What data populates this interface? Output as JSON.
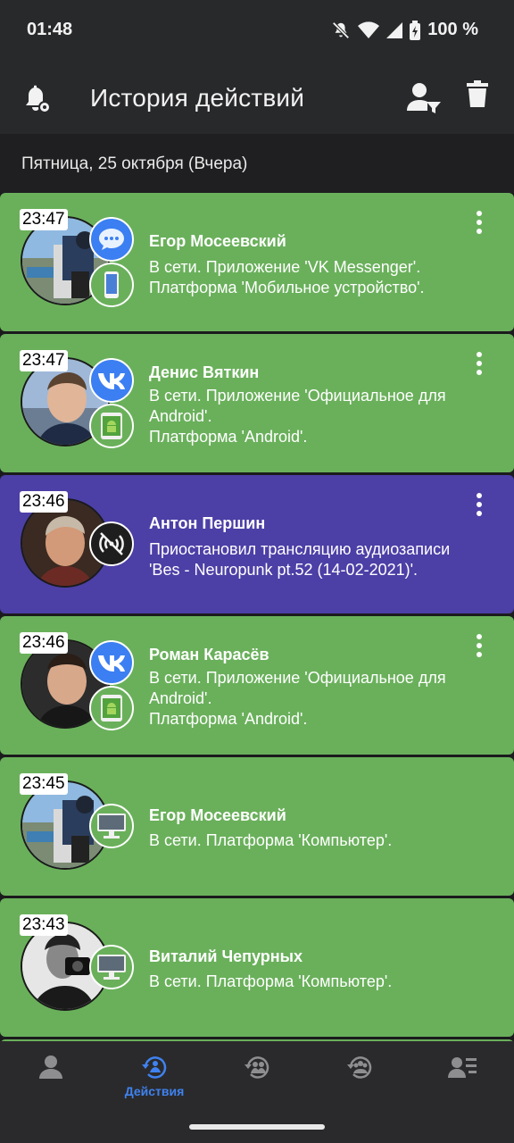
{
  "status_bar": {
    "time": "01:48",
    "battery": "100 %",
    "icons": [
      "mute-icon",
      "wifi-icon",
      "signal-icon",
      "battery-icon"
    ]
  },
  "app_bar": {
    "title": "История действий",
    "icons": [
      "bell-settings-icon",
      "user-filter-icon",
      "trash-icon"
    ]
  },
  "date_header": "Пятница, 25 октября (Вчера)",
  "colors": {
    "online_card": "#6ab05b",
    "audio_card": "#4c3fa6",
    "accent": "#3f82f0",
    "app_bar": "#28292b"
  },
  "events": [
    {
      "time": "23:47",
      "name": "Егор Мосеевский",
      "lines": [
        "В сети. Приложение 'VK Messenger'.",
        "Платформа 'Мобильное устройство'."
      ],
      "badges": [
        "messenger-icon",
        "mobile-phone-icon"
      ]
    },
    {
      "time": "23:47",
      "name": "Денис Вяткин",
      "lines": [
        "В сети. Приложение 'Официальное для",
        "Android'.",
        "Платформа 'Android'."
      ],
      "badges": [
        "vk-logo-icon",
        "android-tablet-icon"
      ]
    },
    {
      "time": "23:46",
      "name": "Антон Першин",
      "lines": [
        "Приостановил трансляцию аудиозаписи",
        "'Bes - Neuropunk pt.52 (14-02-2021)'."
      ],
      "badges": [
        "broadcast-off-icon"
      ]
    },
    {
      "time": "23:46",
      "name": "Роман Карасёв",
      "lines": [
        "В сети. Приложение 'Официальное для",
        "Android'.",
        "Платформа 'Android'."
      ],
      "badges": [
        "vk-logo-icon",
        "android-tablet-icon"
      ]
    },
    {
      "time": "23:45",
      "name": "Егор Мосеевский",
      "lines": [
        "В сети. Платформа 'Компьютер'."
      ],
      "badges": [
        "computer-monitor-icon"
      ]
    },
    {
      "time": "23:43",
      "name": "Виталий Чепурных",
      "lines": [
        "В сети. Платформа 'Компьютер'."
      ],
      "badges": [
        "computer-monitor-icon"
      ]
    }
  ],
  "bottom_nav": {
    "items": [
      {
        "icon": "profile-icon",
        "label": ""
      },
      {
        "icon": "actions-history-icon",
        "label": "Действия",
        "active": true
      },
      {
        "icon": "friends-history-icon",
        "label": ""
      },
      {
        "icon": "groups-history-icon",
        "label": ""
      },
      {
        "icon": "user-list-icon",
        "label": ""
      }
    ]
  }
}
